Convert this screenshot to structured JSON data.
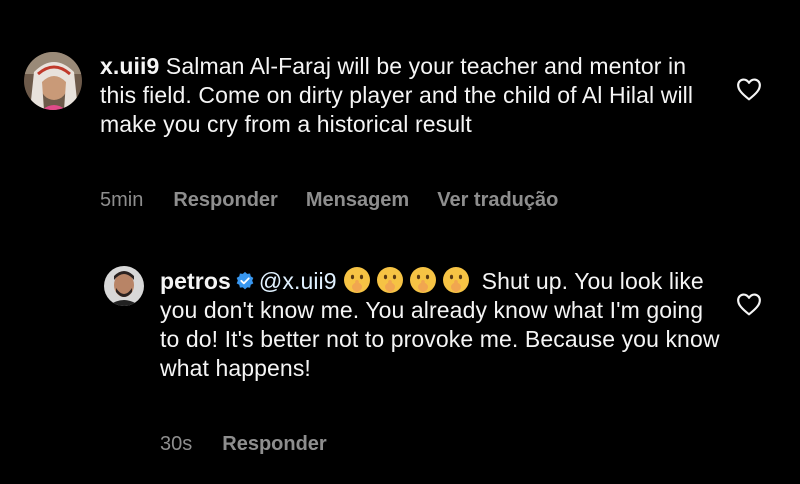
{
  "comments": [
    {
      "username": "x.uii9",
      "verified": false,
      "text": "Salman Al-Faraj will be your teacher and mentor in this field.  Come on dirty player and the child of Al Hilal will make you cry from a historical result",
      "time": "5min",
      "actions": [
        "Responder",
        "Mensagem",
        "Ver tradução"
      ]
    },
    {
      "username": "petros",
      "verified": true,
      "mention": "@x.uii9",
      "emojis": [
        "shushing-face",
        "shushing-face",
        "shushing-face",
        "shushing-face"
      ],
      "text": "Shut up. You look like you don't know me. You already know what I'm going to do! It's better not to provoke me. Because you know what happens!",
      "time": "30s",
      "actions": [
        "Responder"
      ]
    }
  ],
  "colors": {
    "background": "#000000",
    "text": "#f5f5f5",
    "meta": "#8e8e8e",
    "verified": "#3897f0"
  },
  "icons": {
    "like": "heart-outline-icon",
    "verified": "verified-badge-icon"
  }
}
